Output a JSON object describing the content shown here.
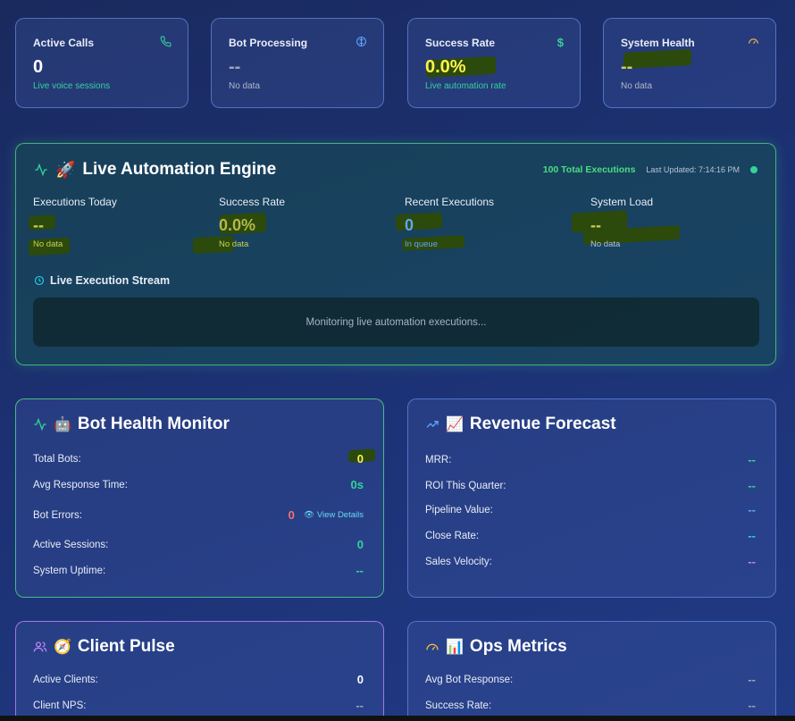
{
  "stats": [
    {
      "label": "Active Calls",
      "value": "0",
      "sub": "Live voice sessions",
      "icon": "phone-icon",
      "icon_color": "#34d399",
      "value_color": "#ffffff",
      "sub_color": "#34d399"
    },
    {
      "label": "Bot Processing",
      "value": "--",
      "sub": "No data",
      "icon": "brain-icon",
      "icon_color": "#60a5fa",
      "value_color": "#9aa5bb",
      "sub_color": "#aeb8cc"
    },
    {
      "label": "Success Rate",
      "value": "0.0%",
      "sub": "Live automation rate",
      "icon": "dollar-icon",
      "icon_color": "#34d399",
      "value_color": "#fff34a",
      "sub_color": "#34d399"
    },
    {
      "label": "System Health",
      "value": "--",
      "sub": "No data",
      "icon": "gauge-icon",
      "icon_color": "#f5b942",
      "value_color": "#c9d05a",
      "sub_color": "#aeb8cc"
    }
  ],
  "engine": {
    "title": "Live Automation Engine",
    "total": "100 Total Executions",
    "updated": "Last Updated: 7:14:16 PM",
    "metrics": [
      {
        "label": "Executions Today",
        "value": "--",
        "sub": "No data",
        "value_color": "#c9d05a",
        "sub_color": "#c9d05a"
      },
      {
        "label": "Success Rate",
        "value": "0.0%",
        "sub": "No data",
        "value_color": "#b4b94a",
        "sub_color": "#c9d05a"
      },
      {
        "label": "Recent Executions",
        "value": "0",
        "sub": "In queue",
        "value_color": "#60a5fa",
        "sub_color": "#60a5fa"
      },
      {
        "label": "System Load",
        "value": "--",
        "sub": "No data",
        "value_color": "#c9d05a",
        "sub_color": "#b5c0d4"
      }
    ],
    "stream_title": "Live Execution Stream",
    "stream_text": "Monitoring live automation executions..."
  },
  "bot_health": {
    "title": "Bot Health Monitor",
    "rows": [
      {
        "label": "Total Bots:",
        "value": "0",
        "color": "#fff34a"
      },
      {
        "label": "Avg Response Time:",
        "value": "0s",
        "color": "#34d399"
      },
      {
        "label": "Bot Errors:",
        "value": "0",
        "color": "#f87171"
      },
      {
        "label": "Active Sessions:",
        "value": "0",
        "color": "#34d399"
      },
      {
        "label": "System Uptime:",
        "value": "--",
        "color": "#34d399"
      }
    ],
    "view_details": "View Details"
  },
  "revenue": {
    "title": "Revenue Forecast",
    "rows": [
      {
        "label": "MRR:",
        "value": "--",
        "color": "#34d399"
      },
      {
        "label": "ROI This Quarter:",
        "value": "--",
        "color": "#34d399"
      },
      {
        "label": "Pipeline Value:",
        "value": "--",
        "color": "#60a5fa"
      },
      {
        "label": "Close Rate:",
        "value": "--",
        "color": "#22d3ee"
      },
      {
        "label": "Sales Velocity:",
        "value": "--",
        "color": "#c084fc"
      }
    ]
  },
  "client_pulse": {
    "title": "Client Pulse",
    "rows": [
      {
        "label": "Active Clients:",
        "value": "0",
        "color": "#ffffff"
      },
      {
        "label": "Client NPS:",
        "value": "--",
        "color": "#9aa5bb"
      }
    ]
  },
  "ops": {
    "title": "Ops Metrics",
    "rows": [
      {
        "label": "Avg Bot Response:",
        "value": "--",
        "color": "#9aa5bb"
      },
      {
        "label": "Success Rate:",
        "value": "--",
        "color": "#9aa5bb"
      }
    ]
  }
}
